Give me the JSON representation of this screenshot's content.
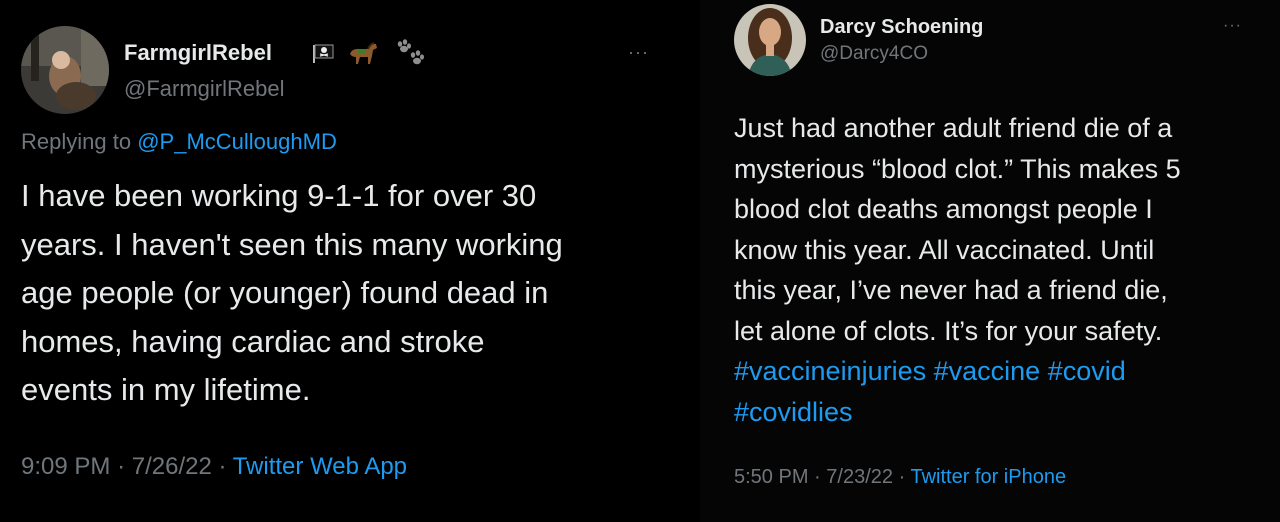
{
  "tweet_left": {
    "display_name": "FarmgirlRebel",
    "handle": "@FarmgirlRebel",
    "badges": [
      "pirate-flag-icon",
      "horse-icon",
      "paw-prints-icon"
    ],
    "more_label": "···",
    "replying_prefix": "Replying to",
    "replying_to": "@P_McCulloughMD",
    "body_lines": [
      "I have been working 9-1-1 for over 30",
      "years. I haven't seen this many working",
      "age people (or younger) found dead in",
      "homes, having cardiac and stroke",
      "events in my lifetime."
    ],
    "time": "9:09 PM",
    "date": "7/26/22",
    "separator": "·",
    "source": "Twitter Web App"
  },
  "tweet_right": {
    "display_name": "Darcy Schoening",
    "handle": "@Darcy4CO",
    "more_label": "···",
    "body_lines": [
      "Just had another adult friend die of a",
      "mysterious “blood clot.” This makes 5",
      "blood clot deaths amongst people I",
      "know this year. All vaccinated. Until",
      "this year, I’ve never had a friend die,",
      "let alone of clots. It’s for your safety."
    ],
    "hashtags_line1": [
      "#vaccineinjuries",
      "#vaccine",
      "#covid"
    ],
    "hashtags_line2": [
      "#covidlies"
    ],
    "time": "5:50 PM",
    "date": "7/23/22",
    "separator": "·",
    "source": "Twitter for iPhone"
  },
  "colors": {
    "background": "#000000",
    "text": "#e7e9ea",
    "muted": "#71767b",
    "link": "#1d9bf0"
  }
}
